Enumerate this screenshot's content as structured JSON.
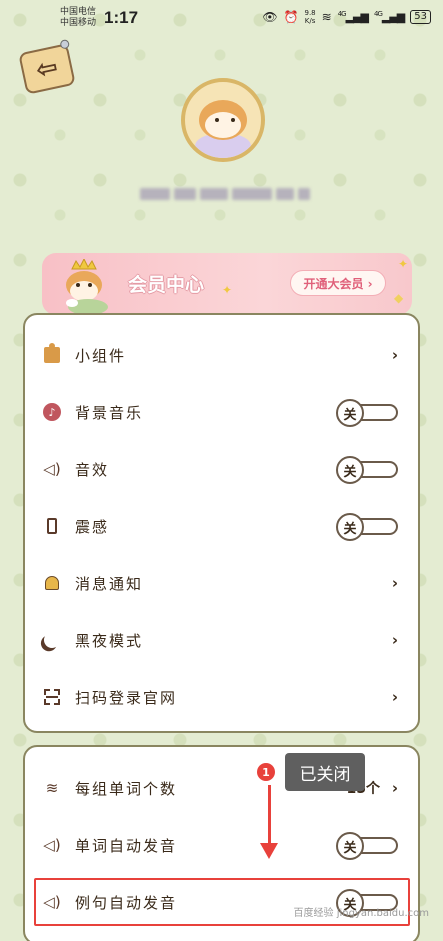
{
  "status_bar": {
    "carrier1": "中国电信",
    "carrier2": "中国移动",
    "time": "1:17",
    "speed_value": "9.8",
    "speed_unit": "K/s",
    "sig1": "4G",
    "sig2": "4G",
    "battery": "53"
  },
  "profile": {
    "back_label": "⇦"
  },
  "vip": {
    "title": "会员中心",
    "button": "开通大会员 ›"
  },
  "settings": {
    "items": [
      {
        "label": "小组件",
        "type": "link",
        "chevron": "›"
      },
      {
        "label": "背景音乐",
        "type": "toggle",
        "state": "关"
      },
      {
        "label": "音效",
        "type": "toggle",
        "state": "关"
      },
      {
        "label": "震感",
        "type": "toggle",
        "state": "关"
      },
      {
        "label": "消息通知",
        "type": "link",
        "chevron": "›"
      },
      {
        "label": "黑夜模式",
        "type": "link",
        "chevron": "›"
      },
      {
        "label": "扫码登录官网",
        "type": "link",
        "chevron": "›"
      }
    ]
  },
  "study": {
    "items": [
      {
        "label": "每组单词个数",
        "value": "15个",
        "chevron": "›"
      },
      {
        "label": "单词自动发音",
        "state": "关"
      },
      {
        "label": "例句自动发音",
        "state": "关"
      }
    ]
  },
  "annotation": {
    "badge": "1",
    "tooltip": "已关闭"
  },
  "watermark": "百度经验 jingyan.baidu.com"
}
